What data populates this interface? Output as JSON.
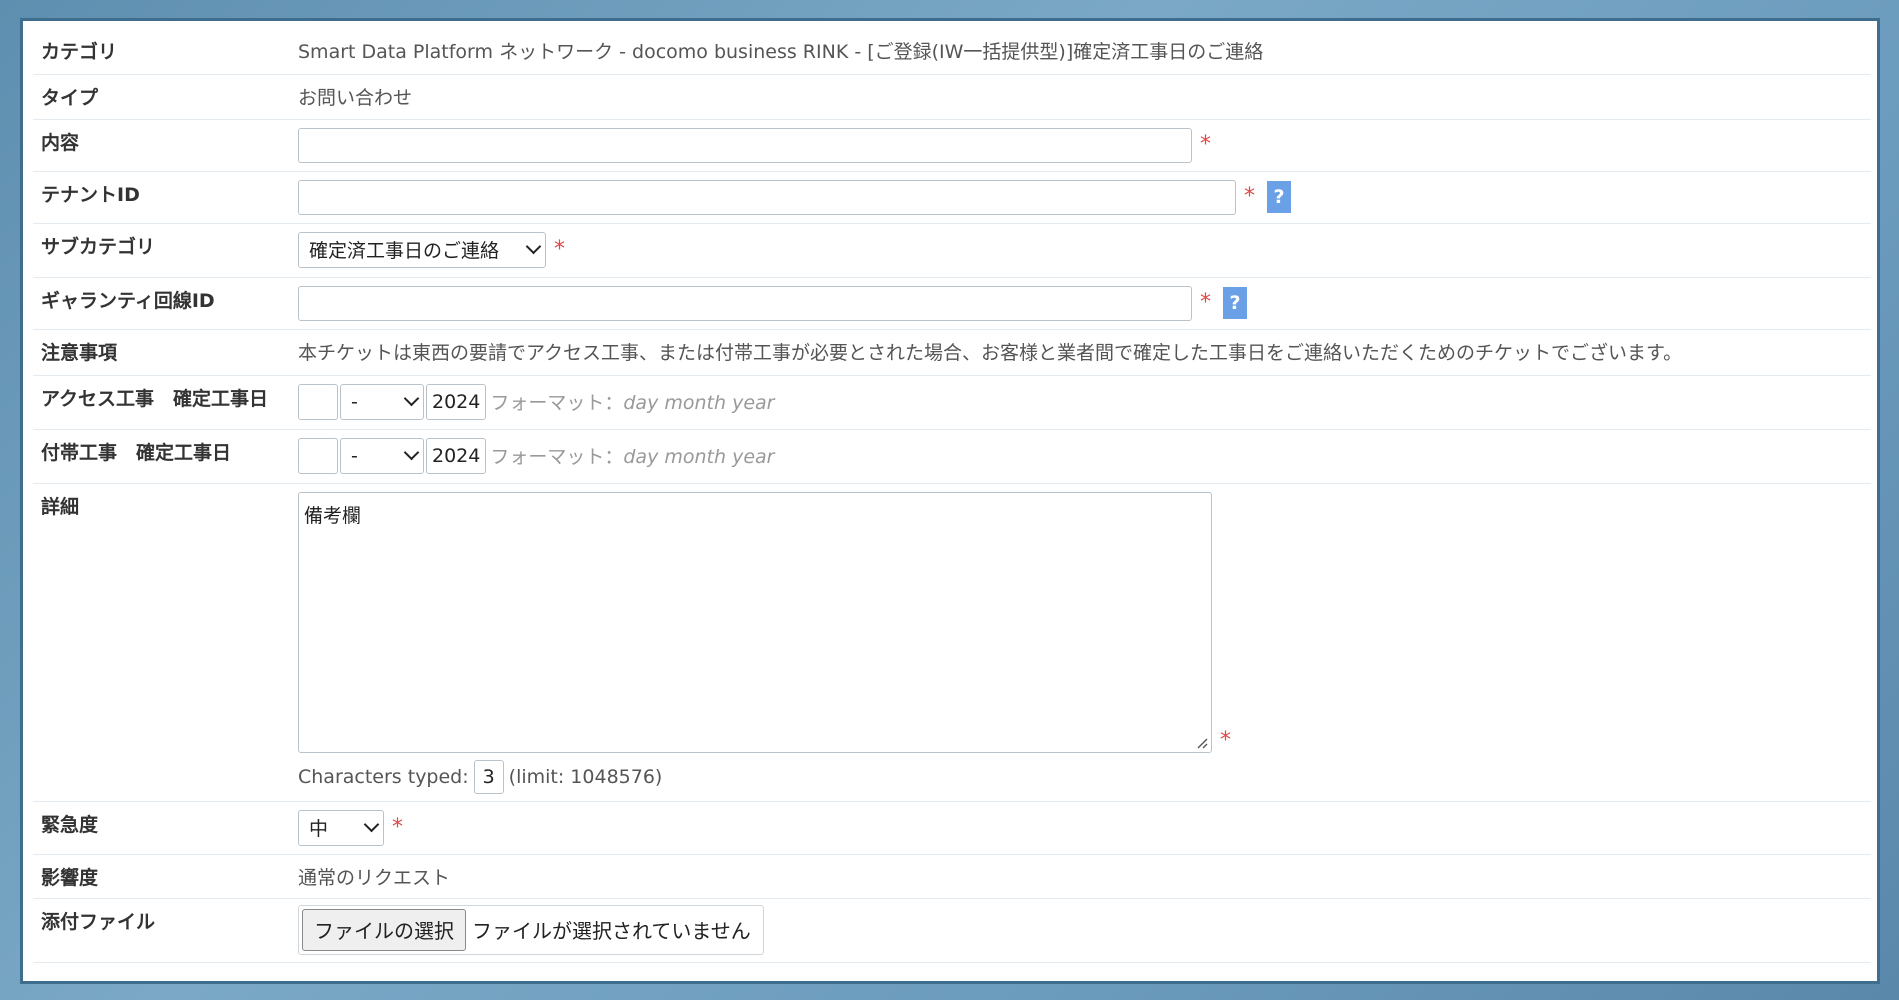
{
  "form": {
    "category": {
      "label": "カテゴリ",
      "value": "Smart Data Platform ネットワーク - docomo business RINK - [ご登録(IW一括提供型)]確定済工事日のご連絡"
    },
    "type": {
      "label": "タイプ",
      "value": "お問い合わせ"
    },
    "content": {
      "label": "内容",
      "value": ""
    },
    "tenant_id": {
      "label": "テナントID",
      "value": "",
      "help": "?"
    },
    "subcategory": {
      "label": "サブカテゴリ",
      "selected": "確定済工事日のご連絡"
    },
    "guarantee_id": {
      "label": "ギャランティ回線ID",
      "value": "",
      "help": "?"
    },
    "notice": {
      "label": "注意事項",
      "value": "本チケットは東西の要請でアクセス工事、または付帯工事が必要とされた場合、お客様と業者間で確定した工事日をご連絡いただくためのチケットでございます。"
    },
    "access_date": {
      "label": "アクセス工事　確定工事日",
      "day": "",
      "month": "-",
      "year": "2024"
    },
    "ancillary_date": {
      "label": "付帯工事　確定工事日",
      "day": "",
      "month": "-",
      "year": "2024"
    },
    "date_format": {
      "prefix": "フォーマット：",
      "pattern": "day month year"
    },
    "details": {
      "label": "詳細",
      "value": "備考欄",
      "chars_prefix": "Characters typed:",
      "chars_count": "3",
      "chars_limit": "(limit: 1048576)"
    },
    "urgency": {
      "label": "緊急度",
      "selected": "中"
    },
    "impact": {
      "label": "影響度",
      "value": "通常のリクエスト"
    },
    "attachment": {
      "label": "添付ファイル",
      "button": "ファイルの選択",
      "status": "ファイルが選択されていません"
    },
    "required_mark": "*"
  },
  "colors": {
    "required": "#e04848",
    "help_bg": "#6aa0e6",
    "frame_border": "#3e6d8e"
  }
}
